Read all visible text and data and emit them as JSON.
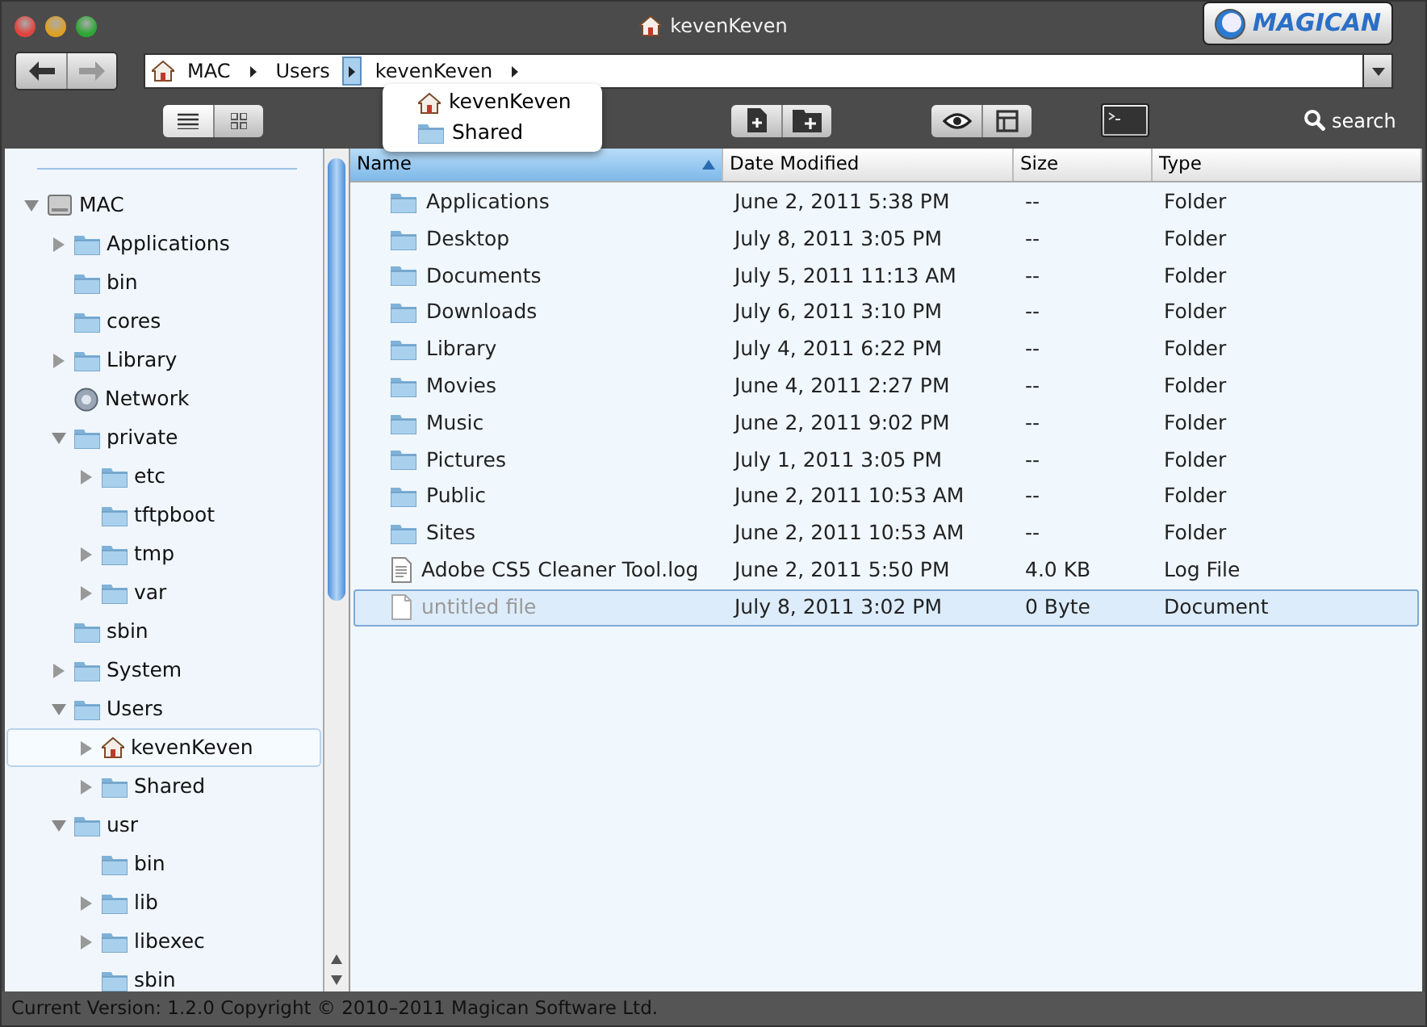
{
  "window": {
    "title": "kevenKeven"
  },
  "logo": {
    "text": "MAGICAN"
  },
  "path_bar": {
    "crumbs": [
      {
        "label": "MAC",
        "menu_open": false
      },
      {
        "label": "Users",
        "menu_open": true
      },
      {
        "label": "kevenKeven",
        "menu_open": false
      }
    ]
  },
  "path_menu": {
    "items": [
      {
        "label": "kevenKeven",
        "kind": "home"
      },
      {
        "label": "Shared",
        "kind": "folder"
      }
    ]
  },
  "toolbar": {
    "view_modes": [
      {
        "kind": "list",
        "selected": true
      },
      {
        "kind": "grid",
        "selected": false
      }
    ],
    "search": {
      "label": "search"
    }
  },
  "sidebar": {
    "tree": [
      {
        "label": "MAC",
        "kind": "drive",
        "expanded": true,
        "selected": false,
        "children": [
          {
            "label": "Applications",
            "kind": "folder",
            "expanded": false,
            "selected": false
          },
          {
            "label": "bin",
            "kind": "folder",
            "selected": false
          },
          {
            "label": "cores",
            "kind": "folder",
            "selected": false
          },
          {
            "label": "Library",
            "kind": "folder",
            "expanded": false,
            "selected": false
          },
          {
            "label": "Network",
            "kind": "network",
            "selected": false
          },
          {
            "label": "private",
            "kind": "folder",
            "expanded": true,
            "selected": false,
            "children": [
              {
                "label": "etc",
                "kind": "folder",
                "expanded": false,
                "selected": false
              },
              {
                "label": "tftpboot",
                "kind": "folder",
                "selected": false
              },
              {
                "label": "tmp",
                "kind": "folder",
                "expanded": false,
                "selected": false
              },
              {
                "label": "var",
                "kind": "folder",
                "expanded": false,
                "selected": false
              }
            ]
          },
          {
            "label": "sbin",
            "kind": "folder",
            "selected": false
          },
          {
            "label": "System",
            "kind": "folder",
            "expanded": false,
            "selected": false
          },
          {
            "label": "Users",
            "kind": "folder",
            "expanded": true,
            "selected": false,
            "children": [
              {
                "label": "kevenKeven",
                "kind": "home",
                "expanded": false,
                "selected": true
              },
              {
                "label": "Shared",
                "kind": "folder",
                "expanded": false,
                "selected": false
              }
            ]
          },
          {
            "label": "usr",
            "kind": "folder",
            "expanded": true,
            "selected": false,
            "children": [
              {
                "label": "bin",
                "kind": "folder",
                "selected": false
              },
              {
                "label": "lib",
                "kind": "folder",
                "expanded": false,
                "selected": false
              },
              {
                "label": "libexec",
                "kind": "folder",
                "expanded": false,
                "selected": false
              },
              {
                "label": "sbin",
                "kind": "folder",
                "selected": false
              }
            ]
          }
        ]
      }
    ]
  },
  "table": {
    "columns": [
      {
        "label": "Name",
        "sorted": true
      },
      {
        "label": "Date Modified",
        "sorted": false
      },
      {
        "label": "Size",
        "sorted": false
      },
      {
        "label": "Type",
        "sorted": false
      }
    ],
    "rows": [
      {
        "kind": "folder",
        "name": "Applications",
        "date": "June 2, 2011 5:38 PM",
        "size": "--",
        "type": "Folder",
        "selected": false,
        "dimmed": false
      },
      {
        "kind": "folder",
        "name": "Desktop",
        "date": "July 8, 2011 3:05 PM",
        "size": "--",
        "type": "Folder",
        "selected": false,
        "dimmed": false
      },
      {
        "kind": "folder",
        "name": "Documents",
        "date": "July 5, 2011 11:13 AM",
        "size": "--",
        "type": "Folder",
        "selected": false,
        "dimmed": false
      },
      {
        "kind": "folder",
        "name": "Downloads",
        "date": "July 6, 2011 3:10 PM",
        "size": "--",
        "type": "Folder",
        "selected": false,
        "dimmed": false
      },
      {
        "kind": "folder",
        "name": "Library",
        "date": "July 4, 2011 6:22 PM",
        "size": "--",
        "type": "Folder",
        "selected": false,
        "dimmed": false
      },
      {
        "kind": "folder",
        "name": "Movies",
        "date": "June 4, 2011 2:27 PM",
        "size": "--",
        "type": "Folder",
        "selected": false,
        "dimmed": false
      },
      {
        "kind": "folder",
        "name": "Music",
        "date": "June 2, 2011 9:02 PM",
        "size": "--",
        "type": "Folder",
        "selected": false,
        "dimmed": false
      },
      {
        "kind": "folder",
        "name": "Pictures",
        "date": "July 1, 2011 3:05 PM",
        "size": "--",
        "type": "Folder",
        "selected": false,
        "dimmed": false
      },
      {
        "kind": "folder",
        "name": "Public",
        "date": "June 2, 2011 10:53 AM",
        "size": "--",
        "type": "Folder",
        "selected": false,
        "dimmed": false
      },
      {
        "kind": "folder",
        "name": "Sites",
        "date": "June 2, 2011 10:53 AM",
        "size": "--",
        "type": "Folder",
        "selected": false,
        "dimmed": false
      },
      {
        "kind": "log",
        "name": "Adobe CS5 Cleaner Tool.log",
        "date": "June 2, 2011 5:50 PM",
        "size": "4.0 KB",
        "type": "Log File",
        "selected": false,
        "dimmed": false
      },
      {
        "kind": "document",
        "name": "untitled file",
        "date": "July 8, 2011 3:02 PM",
        "size": "0 Byte",
        "type": "Document",
        "selected": true,
        "dimmed": true
      }
    ]
  },
  "status_bar": {
    "text": "Current Version: 1.2.0 Copyright © 2010–2011 Magican Software Ltd."
  }
}
